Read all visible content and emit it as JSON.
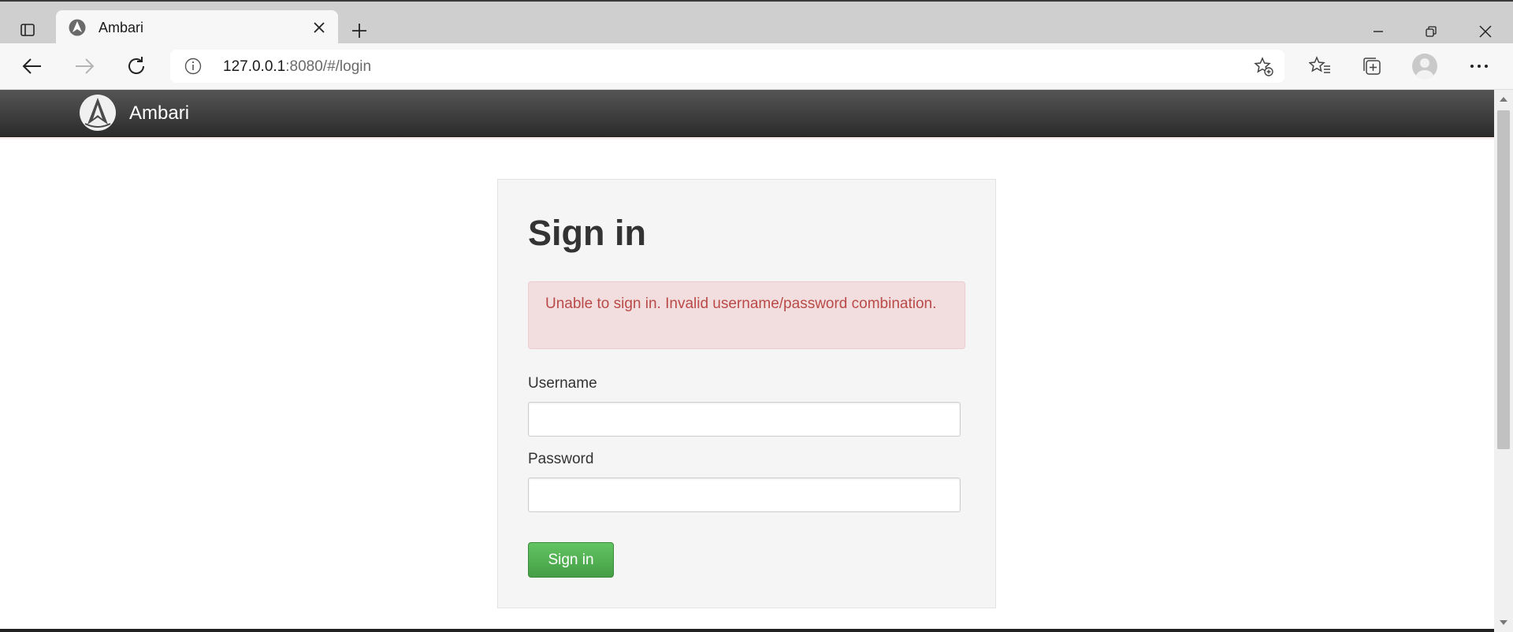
{
  "browser": {
    "tab": {
      "title": "Ambari",
      "icon": "ambari-logo-icon"
    },
    "url": {
      "host": "127.0.0.1",
      "rest": ":8080/#/login"
    },
    "icons": {
      "tab_actions": "tab-actions-icon",
      "close_tab": "close-icon",
      "new_tab": "plus-icon",
      "minimize": "minimize-icon",
      "restore": "restore-icon",
      "close_window": "close-icon",
      "back": "back-arrow-icon",
      "forward": "forward-arrow-icon",
      "refresh": "refresh-icon",
      "site_info": "info-icon",
      "add_favorite": "add-favorite-icon",
      "favorites": "favorites-icon",
      "collections": "collections-icon",
      "profile": "profile-avatar-icon",
      "more": "more-icon"
    }
  },
  "app": {
    "brand": "Ambari"
  },
  "login": {
    "title": "Sign in",
    "error": "Unable to sign in. Invalid username/password combination.",
    "username_label": "Username",
    "username_value": "",
    "password_label": "Password",
    "password_value": "",
    "submit_label": "Sign in"
  },
  "colors": {
    "navbar": "#333333",
    "error_bg": "#f2dede",
    "error_text": "#b94a48",
    "button_green": "#51a351"
  }
}
